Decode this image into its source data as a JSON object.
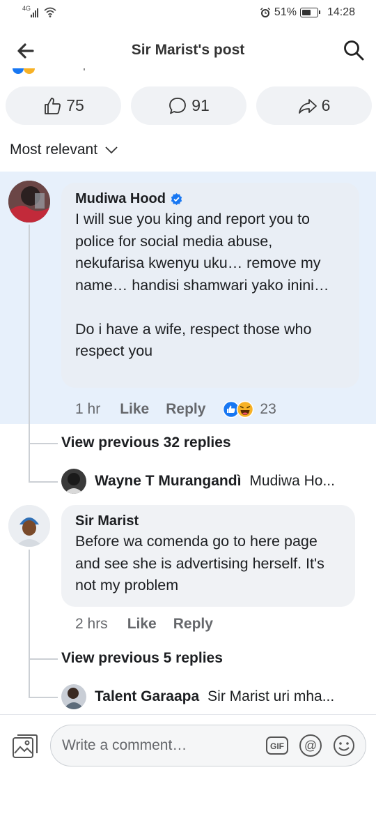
{
  "status_bar": {
    "network": "4G",
    "battery": "51%",
    "time": "14:28"
  },
  "header": {
    "title": "Sir Marist's post",
    "back_icon": "arrow-left-icon",
    "search_icon": "search-icon"
  },
  "reactions": {
    "likes": "75",
    "comments": "91",
    "shares": "6"
  },
  "sort": {
    "label": "Most relevant"
  },
  "comments": [
    {
      "author": "Mudiwa Hood",
      "verified": true,
      "text": "I will sue you king and report you to police for social media abuse, nekufarisa kwenyu uku… remove my name… handisi shamwari yako inini…\n\nDo i have a wife, respect those who respect you",
      "time": "1 hr",
      "like_label": "Like",
      "reply_label": "Reply",
      "reaction_count": "23",
      "view_previous": "View previous 32 replies",
      "latest_reply": {
        "author": "Wayne T Murangandì",
        "snippet": "Mudiwa Ho..."
      }
    },
    {
      "author": "Sir Marist",
      "verified": false,
      "text": "Before wa comenda go to here page and see she is advertising herself. It's not my problem",
      "time": "2 hrs",
      "like_label": "Like",
      "reply_label": "Reply",
      "view_previous": "View previous 5 replies",
      "latest_reply": {
        "author": "Talent Garaapa",
        "snippet": "Sir Marist uri mha..."
      }
    }
  ],
  "composer": {
    "placeholder": "Write a comment…",
    "gif_label": "GIF",
    "at_label": "@"
  },
  "colors": {
    "highlight_bg": "#e7f0fb",
    "bubble_bg": "#f0f2f5",
    "like_blue": "#1877f2",
    "verified_blue": "#1877f2",
    "secondary_text": "#65676b"
  }
}
